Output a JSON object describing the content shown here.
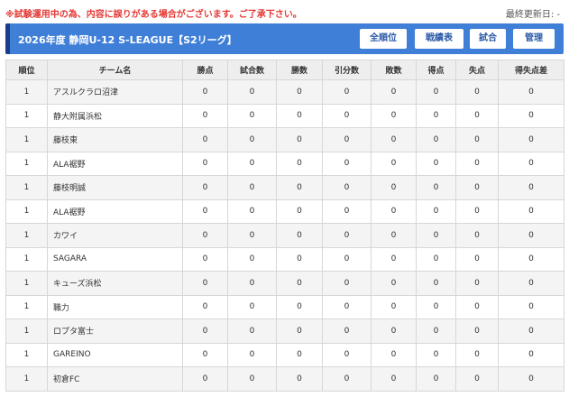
{
  "notice": "※試験運用中の為、内容に誤りがある場合がございます。ご了承下さい。",
  "updated": "最終更新日: -",
  "header": {
    "title": "2026年度 静岡U-12 S-LEAGUE【S2リーグ】",
    "buttons": [
      "全順位",
      "戦績表",
      "試合",
      "管理"
    ]
  },
  "table": {
    "columns": [
      "順位",
      "チーム名",
      "勝点",
      "試合数",
      "勝数",
      "引分数",
      "敗数",
      "得点",
      "失点",
      "得失点差"
    ],
    "rows": [
      [
        "1",
        "アスルクラロ沼津",
        "0",
        "0",
        "0",
        "0",
        "0",
        "0",
        "0",
        "0"
      ],
      [
        "1",
        "静大附属浜松",
        "0",
        "0",
        "0",
        "0",
        "0",
        "0",
        "0",
        "0"
      ],
      [
        "1",
        "藤枝東",
        "0",
        "0",
        "0",
        "0",
        "0",
        "0",
        "0",
        "0"
      ],
      [
        "1",
        "ALA裾野",
        "0",
        "0",
        "0",
        "0",
        "0",
        "0",
        "0",
        "0"
      ],
      [
        "1",
        "藤枝明誠",
        "0",
        "0",
        "0",
        "0",
        "0",
        "0",
        "0",
        "0"
      ],
      [
        "1",
        "ALA裾野",
        "0",
        "0",
        "0",
        "0",
        "0",
        "0",
        "0",
        "0"
      ],
      [
        "1",
        "カワイ",
        "0",
        "0",
        "0",
        "0",
        "0",
        "0",
        "0",
        "0"
      ],
      [
        "1",
        "SAGARA",
        "0",
        "0",
        "0",
        "0",
        "0",
        "0",
        "0",
        "0"
      ],
      [
        "1",
        "キューズ浜松",
        "0",
        "0",
        "0",
        "0",
        "0",
        "0",
        "0",
        "0"
      ],
      [
        "1",
        "職力",
        "0",
        "0",
        "0",
        "0",
        "0",
        "0",
        "0",
        "0"
      ],
      [
        "1",
        "ロプタ富士",
        "0",
        "0",
        "0",
        "0",
        "0",
        "0",
        "0",
        "0"
      ],
      [
        "1",
        "GAREINO",
        "0",
        "0",
        "0",
        "0",
        "0",
        "0",
        "0",
        "0"
      ],
      [
        "1",
        "初倉FC",
        "0",
        "0",
        "0",
        "0",
        "0",
        "0",
        "0",
        "0"
      ]
    ]
  },
  "colors": {
    "header_bg": "#3f7fd8",
    "header_accent": "#1a3d8c",
    "notice": "#e53935",
    "button_text": "#2c5aa8"
  }
}
